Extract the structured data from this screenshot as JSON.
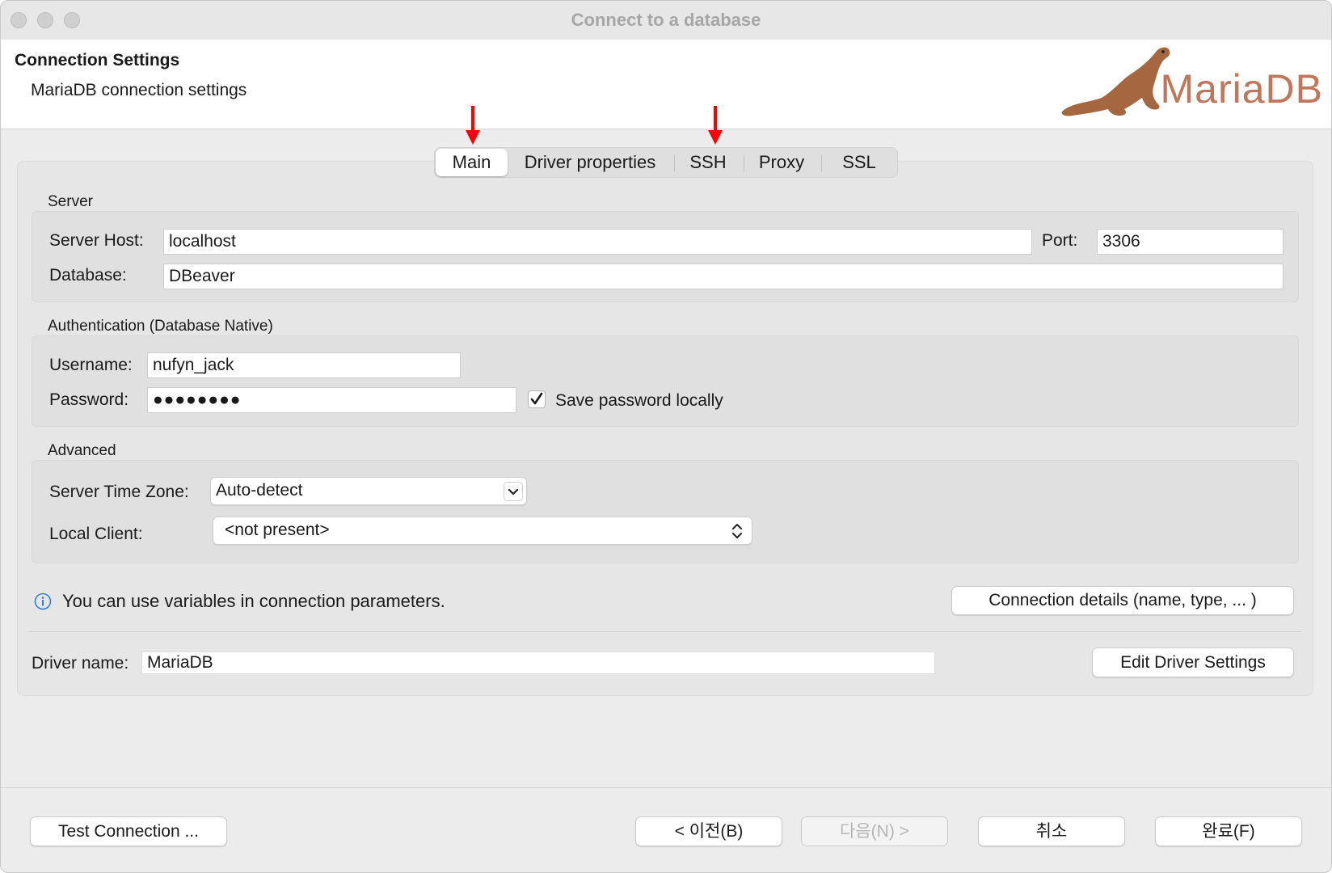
{
  "window": {
    "title": "Connect to a database"
  },
  "header": {
    "title": "Connection Settings",
    "subtitle": "MariaDB connection settings",
    "logo_text": "MariaDB"
  },
  "tabs": [
    {
      "label": "Main",
      "active": true
    },
    {
      "label": "Driver properties",
      "active": false
    },
    {
      "label": "SSH",
      "active": false
    },
    {
      "label": "Proxy",
      "active": false
    },
    {
      "label": "SSL",
      "active": false
    }
  ],
  "server": {
    "group_title": "Server",
    "host_label": "Server Host:",
    "host_value": "localhost",
    "port_label": "Port:",
    "port_value": "3306",
    "database_label": "Database:",
    "database_value": "DBeaver"
  },
  "auth": {
    "group_title": "Authentication (Database Native)",
    "username_label": "Username:",
    "username_value": "nufyn_jack",
    "password_label": "Password:",
    "password_value": "●●●●●●●●",
    "save_password_label": "Save password locally",
    "save_password_checked": true
  },
  "advanced": {
    "group_title": "Advanced",
    "timezone_label": "Server Time Zone:",
    "timezone_value": "Auto-detect",
    "local_client_label": "Local Client:",
    "local_client_value": "<not present>"
  },
  "info": {
    "message": "You can use variables in connection parameters.",
    "details_button": "Connection details (name, type, ... )"
  },
  "driver": {
    "name_label": "Driver name:",
    "name_value": "MariaDB",
    "edit_button": "Edit Driver Settings"
  },
  "footer": {
    "test_button": "Test Connection ...",
    "back_button": "< 이전(B)",
    "next_button": "다음(N) >",
    "cancel_button": "취소",
    "finish_button": "완료(F)"
  },
  "annotations": {
    "arrow_color": "#ff0000"
  },
  "colors": {
    "logo_brown": "#c0765a",
    "logo_seal": "#a5673f"
  }
}
